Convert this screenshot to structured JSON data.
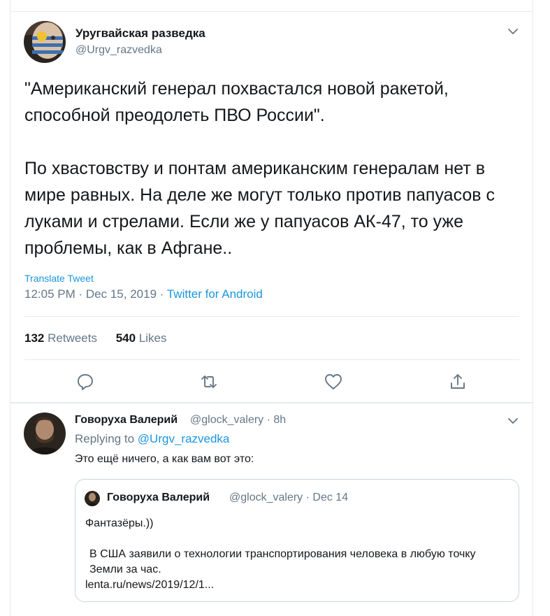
{
  "tweet": {
    "author_name": "Уругвайская разведка",
    "author_handle": "@Urgv_razvedka",
    "paragraphs": [
      "\"Американский генерал похвастался новой ракетой, способной преодолеть ПВО России\".",
      "По хвастовству и понтам американским генералам нет в мире равных. На деле же могут только против папуасов с луками и стрелами. Если же у папуасов АК-47, то уже проблемы, как в Афгане.."
    ],
    "translate_label": "Translate Tweet",
    "time": "12:05 PM",
    "date": "Dec 15, 2019",
    "source": "Twitter for Android",
    "retweets_count": "132",
    "retweets_label": "Retweets",
    "likes_count": "540",
    "likes_label": "Likes"
  },
  "reply": {
    "author_name": "Говоруха Валерий",
    "author_handle": "@glock_valery",
    "time": "8h",
    "replying_label": "Replying to",
    "replying_to": "@Urgv_razvedka",
    "text": "Это ещё ничего, а как вам вот это:"
  },
  "quoted": {
    "author_name": "Говоруха Валерий",
    "author_handle": "@glock_valery",
    "date": "Dec 14",
    "line1": "Фантазёры.))",
    "line2": "В США заявили о технологии транспортирования человека в любую точку Земли за час.",
    "link": "lenta.ru/news/2019/12/1..."
  },
  "colors": {
    "accent": "#1b95e0",
    "secondary_text": "#657786",
    "border": "#e6ecf0"
  },
  "icons": [
    "chevron-down-icon",
    "reply-icon",
    "retweet-icon",
    "like-icon",
    "share-icon"
  ]
}
